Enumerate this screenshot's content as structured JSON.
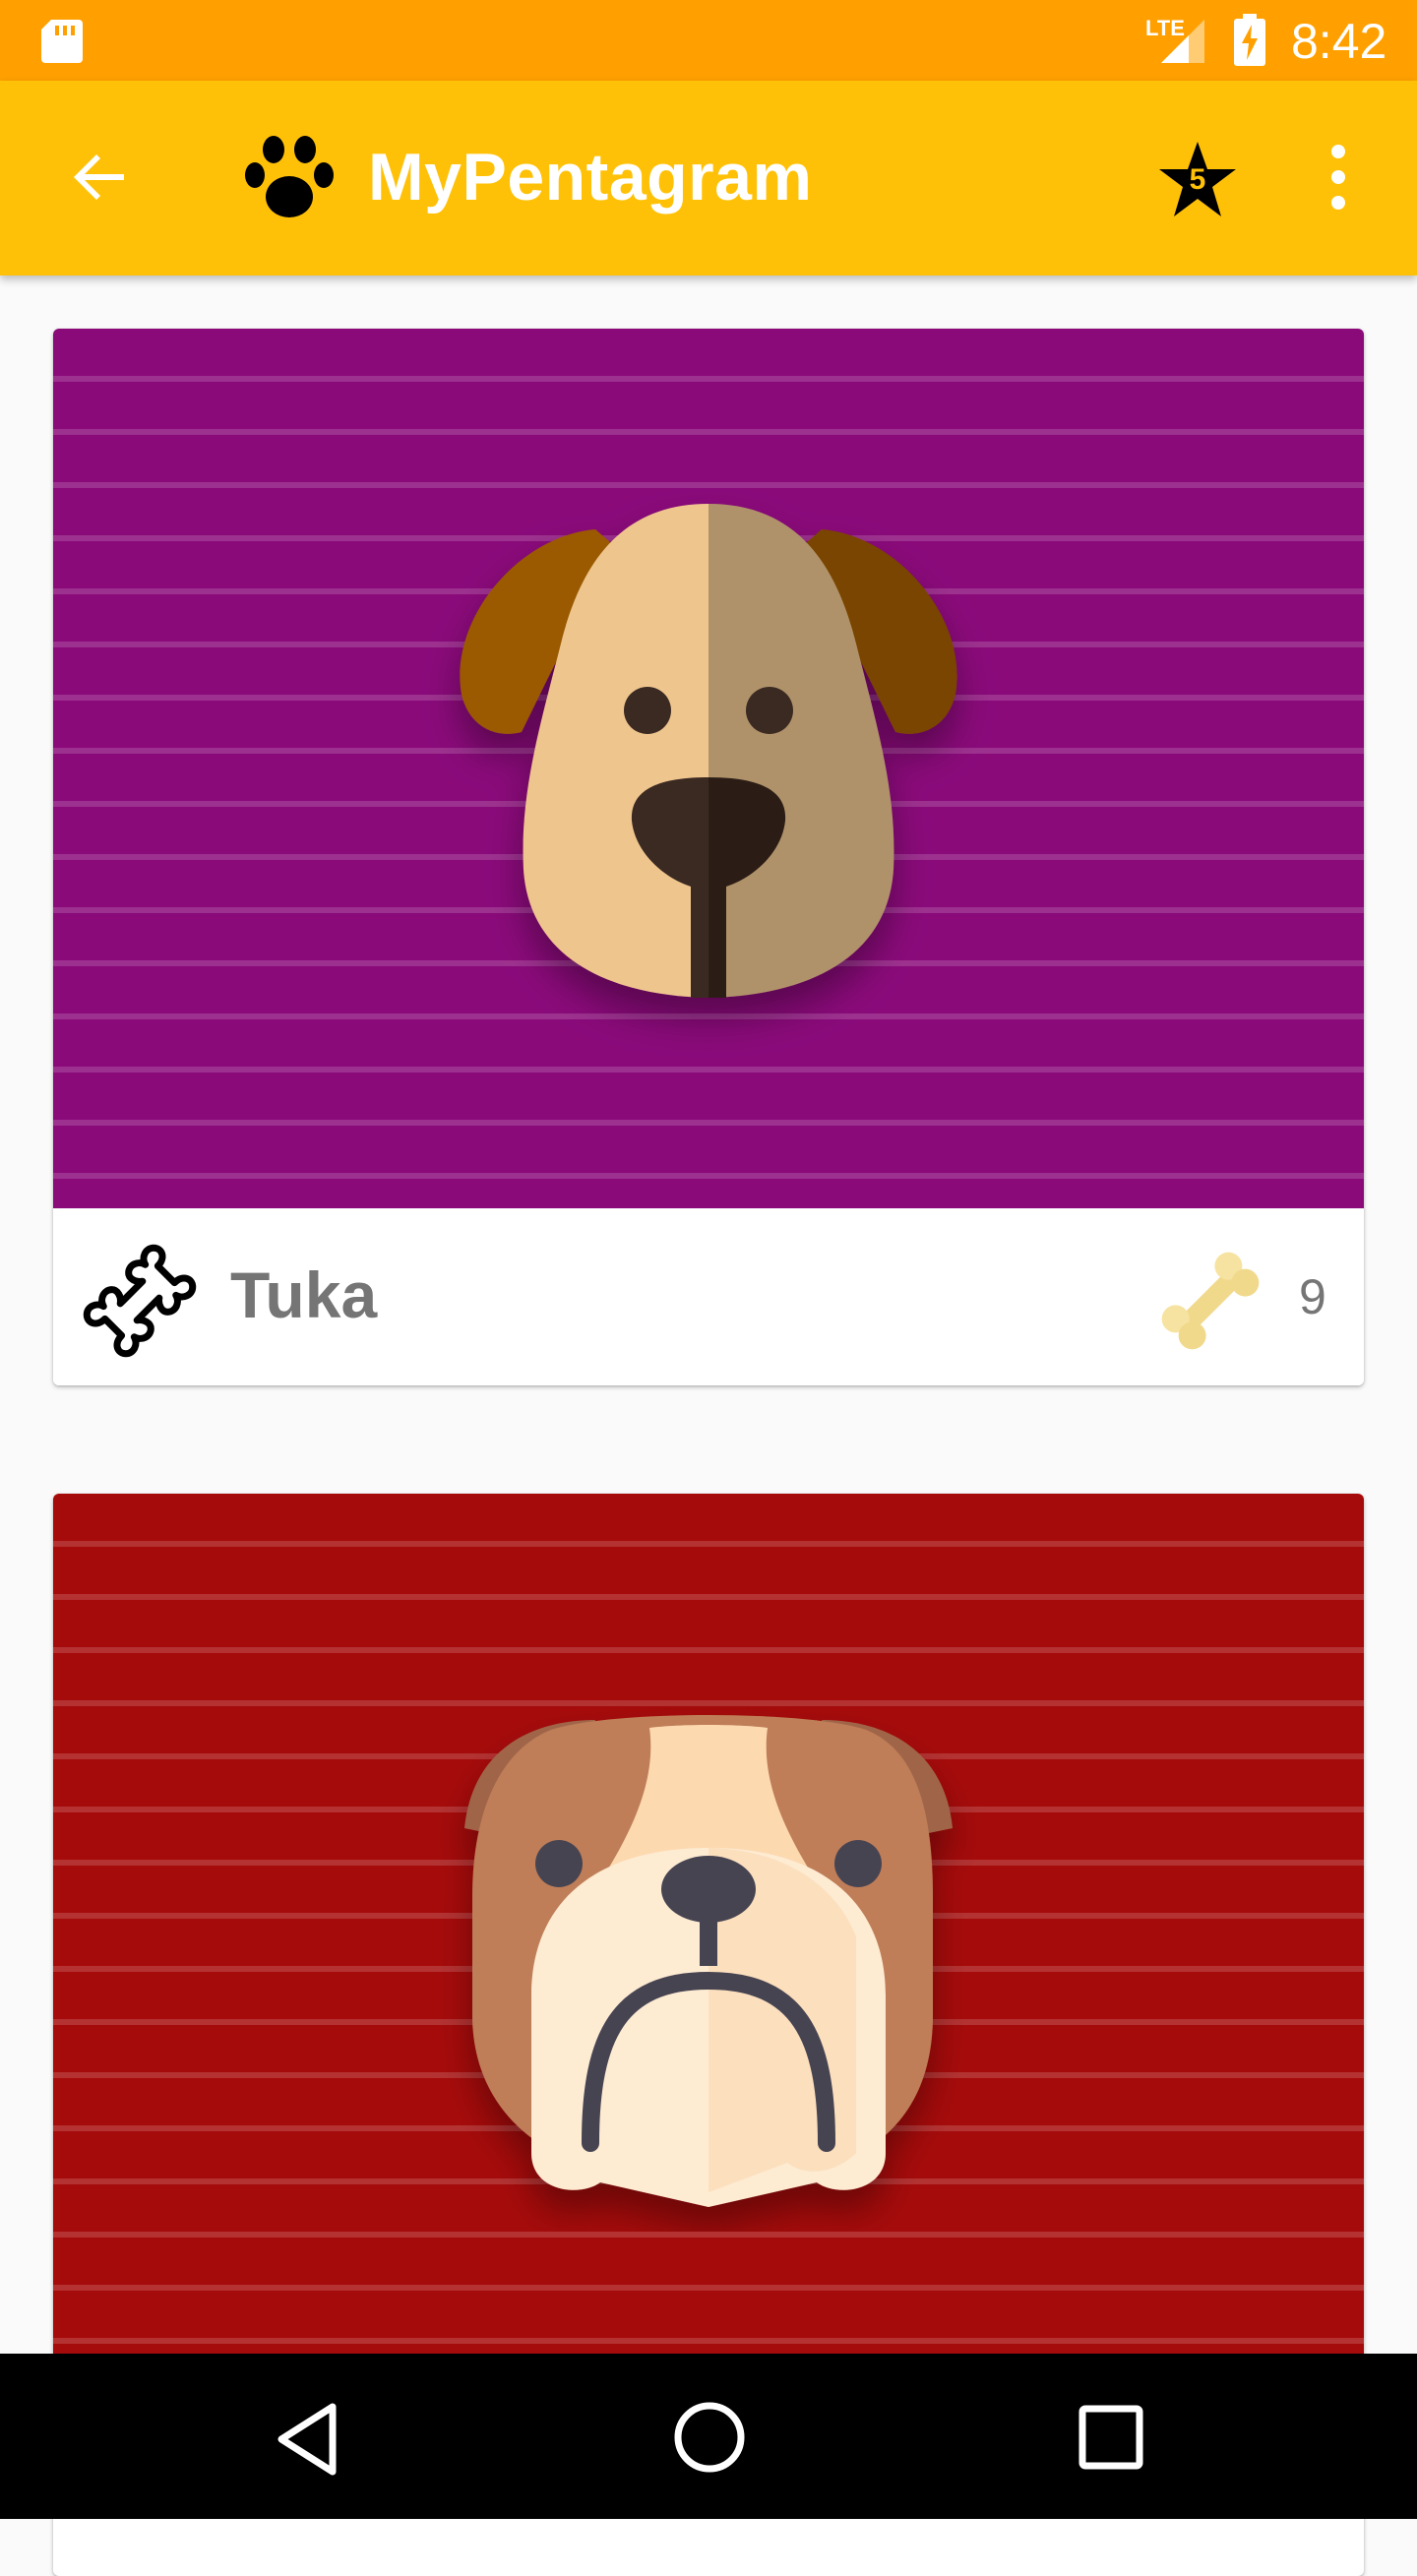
{
  "status_bar": {
    "network_label": "LTE",
    "time": "8:42",
    "icons": [
      "sd-card-icon",
      "signal-icon",
      "battery-charging-icon"
    ]
  },
  "app_bar": {
    "title": "MyPentagram",
    "star_badge_count": "5",
    "icons": [
      "back-arrow-icon",
      "paw-icon",
      "star-icon",
      "overflow-menu-icon"
    ],
    "background_color": "#ffc107"
  },
  "dogs": [
    {
      "name": "Tuka",
      "bone_count": "9",
      "background_color": "#8a0a7a",
      "illustration": "beagle-dog-face-icon"
    },
    {
      "name": "",
      "bone_count": "",
      "background_color": "#a60b0b",
      "illustration": "bulldog-face-icon"
    }
  ],
  "nav_bar": {
    "icons": [
      "nav-back-icon",
      "nav-home-icon",
      "nav-recents-icon"
    ]
  }
}
